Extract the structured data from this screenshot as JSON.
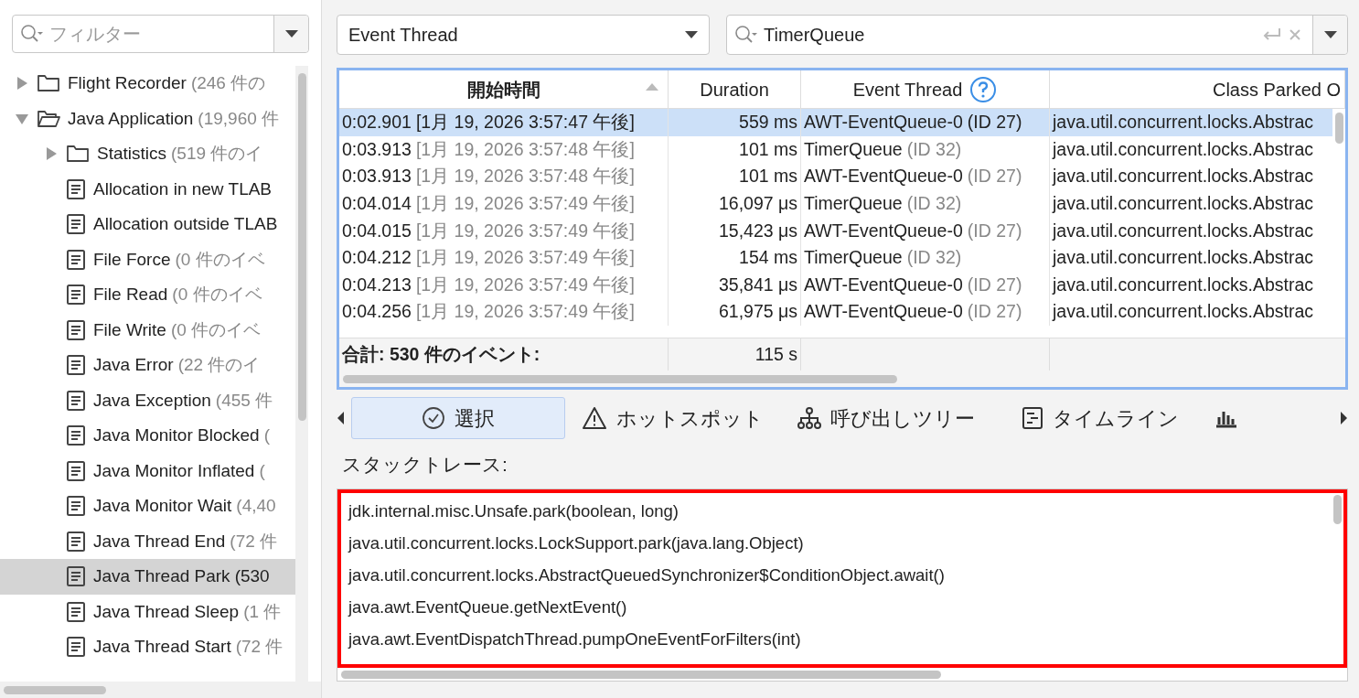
{
  "filter": {
    "placeholder": "フィルター"
  },
  "tree": [
    {
      "name": "Flight Recorder",
      "count": "(246 件の",
      "kind": "folder",
      "expanded": false,
      "selected": false
    },
    {
      "name": "Java Application",
      "count": "(19,960 件",
      "kind": "folder",
      "expanded": true,
      "selected": false,
      "children": [
        {
          "name": "Statistics",
          "count": "(519 件のイ",
          "kind": "folder",
          "expanded": false,
          "selected": false
        },
        {
          "name": "Allocation in new TLAB",
          "kind": "event",
          "selected": false
        },
        {
          "name": "Allocation outside TLAB",
          "kind": "event",
          "selected": false
        },
        {
          "name": "File Force",
          "count": "(0 件のイベ",
          "kind": "event",
          "selected": false
        },
        {
          "name": "File Read",
          "count": "(0 件のイベ",
          "kind": "event",
          "selected": false
        },
        {
          "name": "File Write",
          "count": "(0 件のイベ",
          "kind": "event",
          "selected": false
        },
        {
          "name": "Java Error",
          "count": "(22 件のイ",
          "kind": "event",
          "selected": false
        },
        {
          "name": "Java Exception",
          "count": "(455 件",
          "kind": "event",
          "selected": false
        },
        {
          "name": "Java Monitor Blocked",
          "count": "(",
          "kind": "event",
          "selected": false
        },
        {
          "name": "Java Monitor Inflated",
          "count": "(",
          "kind": "event",
          "selected": false
        },
        {
          "name": "Java Monitor Wait",
          "count": "(4,40",
          "kind": "event",
          "selected": false
        },
        {
          "name": "Java Thread End",
          "count": "(72 件",
          "kind": "event",
          "selected": false
        },
        {
          "name": "Java Thread Park",
          "count": "(530",
          "kind": "event",
          "selected": true
        },
        {
          "name": "Java Thread Sleep",
          "count": "(1 件",
          "kind": "event",
          "selected": false
        },
        {
          "name": "Java Thread Start",
          "count": "(72 件",
          "kind": "event",
          "selected": false
        }
      ]
    }
  ],
  "thread_dropdown": {
    "value": "Event Thread"
  },
  "search": {
    "value": "TimerQueue"
  },
  "table": {
    "columns": [
      {
        "label": "開始時間",
        "sorted": true
      },
      {
        "label": "Duration",
        "sorted": false
      },
      {
        "label": "Event Thread",
        "sorted": false
      },
      {
        "label": "Class Parked O",
        "sorted": false
      }
    ],
    "rows": [
      {
        "start": "0:02.901",
        "date": "[1月 19, 2026 3:57:47 午後]",
        "duration": "559 ms",
        "thread": "AWT-EventQueue-0",
        "id": "(ID 27)",
        "class": "java.util.concurrent.locks.Abstrac",
        "selected": true
      },
      {
        "start": "0:03.913",
        "date": "[1月 19, 2026 3:57:48 午後]",
        "duration": "101 ms",
        "thread": "TimerQueue",
        "id": "(ID 32)",
        "class": "java.util.concurrent.locks.Abstrac",
        "selected": false
      },
      {
        "start": "0:03.913",
        "date": "[1月 19, 2026 3:57:48 午後]",
        "duration": "101 ms",
        "thread": "AWT-EventQueue-0",
        "id": "(ID 27)",
        "class": "java.util.concurrent.locks.Abstrac",
        "selected": false
      },
      {
        "start": "0:04.014",
        "date": "[1月 19, 2026 3:57:49 午後]",
        "duration": "16,097 μs",
        "thread": "TimerQueue",
        "id": "(ID 32)",
        "class": "java.util.concurrent.locks.Abstrac",
        "selected": false
      },
      {
        "start": "0:04.015",
        "date": "[1月 19, 2026 3:57:49 午後]",
        "duration": "15,423 μs",
        "thread": "AWT-EventQueue-0",
        "id": "(ID 27)",
        "class": "java.util.concurrent.locks.Abstrac",
        "selected": false
      },
      {
        "start": "0:04.212",
        "date": "[1月 19, 2026 3:57:49 午後]",
        "duration": "154 ms",
        "thread": "TimerQueue",
        "id": "(ID 32)",
        "class": "java.util.concurrent.locks.Abstrac",
        "selected": false
      },
      {
        "start": "0:04.213",
        "date": "[1月 19, 2026 3:57:49 午後]",
        "duration": "35,841 μs",
        "thread": "AWT-EventQueue-0",
        "id": "(ID 27)",
        "class": "java.util.concurrent.locks.Abstrac",
        "selected": false
      },
      {
        "start": "0:04.256",
        "date": "[1月 19, 2026 3:57:49 午後]",
        "duration": "61,975 μs",
        "thread": "AWT-EventQueue-0",
        "id": "(ID 27)",
        "class": "java.util.concurrent.locks.Abstrac",
        "selected": false
      }
    ],
    "total": {
      "label": "合計: 530 件のイベント:",
      "duration": "115 s"
    }
  },
  "tabs": [
    {
      "label": "選択",
      "kind": "check",
      "selected": true
    },
    {
      "label": "ホットスポット",
      "kind": "warning",
      "selected": false
    },
    {
      "label": "呼び出しツリー",
      "kind": "tree",
      "selected": false
    },
    {
      "label": "タイムライン",
      "kind": "timeline",
      "selected": false
    },
    {
      "kind": "chart",
      "selected": false
    }
  ],
  "stack_trace": {
    "label": "スタックトレース:",
    "lines": [
      "jdk.internal.misc.Unsafe.park(boolean, long)",
      "java.util.concurrent.locks.LockSupport.park(java.lang.Object)",
      "java.util.concurrent.locks.AbstractQueuedSynchronizer$ConditionObject.await()",
      "java.awt.EventQueue.getNextEvent()",
      "java.awt.EventDispatchThread.pumpOneEventForFilters(int)"
    ]
  }
}
